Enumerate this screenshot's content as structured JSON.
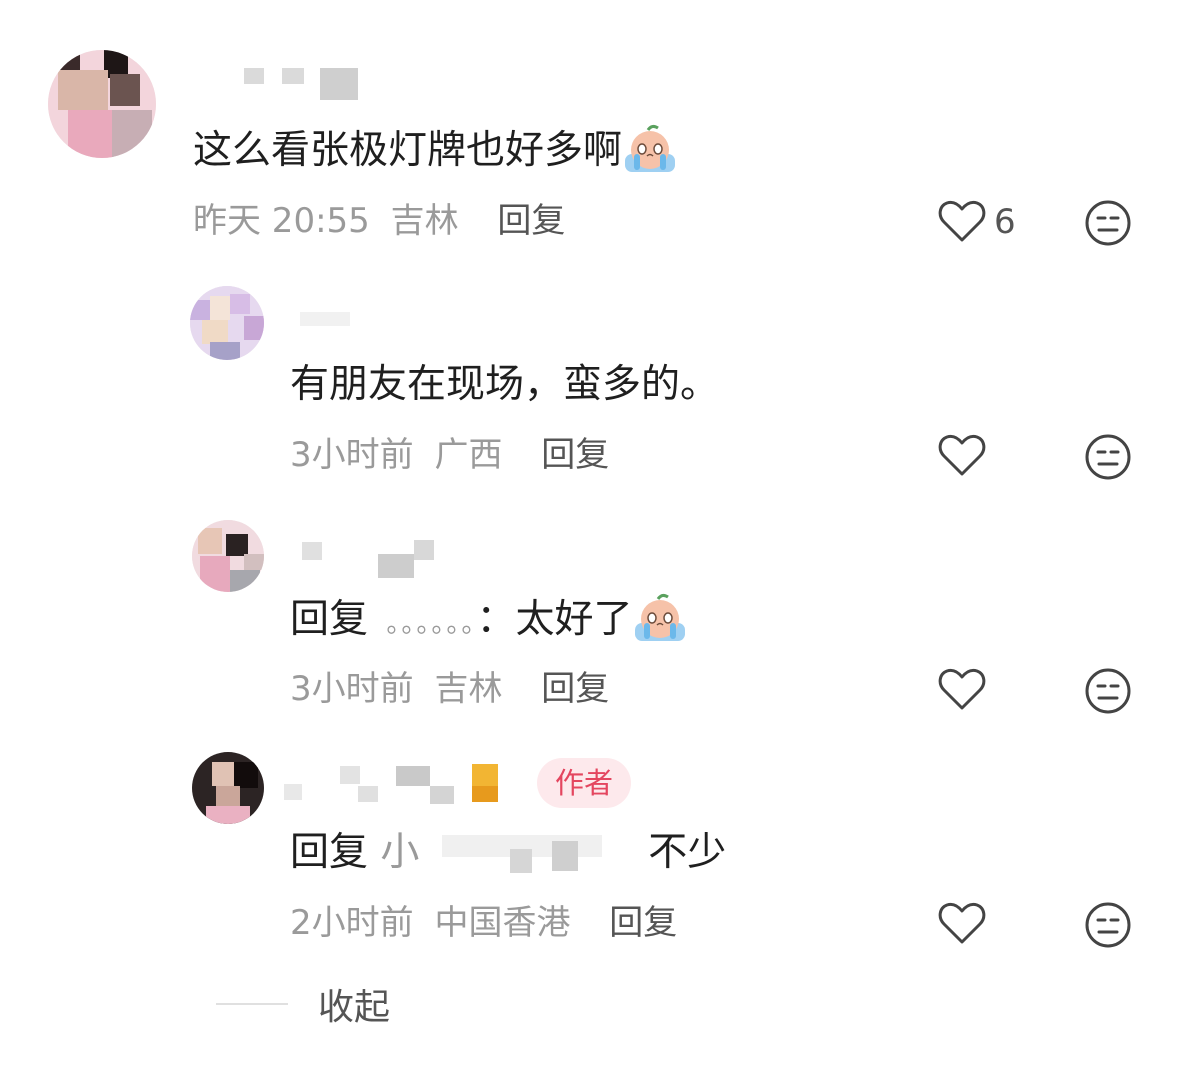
{
  "comments": [
    {
      "text": "这么看张极灯牌也好多啊",
      "time": "昨天 20:55",
      "location": "吉林",
      "reply_label": "回复",
      "like_count": "6",
      "emoji": "crying-emoji"
    },
    {
      "text": "有朋友在现场，蛮多的。",
      "time": "3小时前",
      "location": "广西",
      "reply_label": "回复"
    },
    {
      "reply_prefix": "回复",
      "mention": "。。。。。。",
      "text": "：太好了",
      "time": "3小时前",
      "location": "吉林",
      "reply_label": "回复",
      "emoji": "crying-emoji"
    },
    {
      "reply_prefix": "回复",
      "mention_partial": "小",
      "text": "不少",
      "badge": "作者",
      "time": "2小时前",
      "location": "中国香港",
      "reply_label": "回复"
    }
  ],
  "collapse_label": "收起",
  "colors": {
    "badge_bg": "#fde9ec",
    "badge_text": "#e4465f",
    "meta_gray": "#9a9a9a"
  },
  "icons": {
    "like": "heart-outline-icon",
    "dislike": "neutral-face-icon"
  }
}
